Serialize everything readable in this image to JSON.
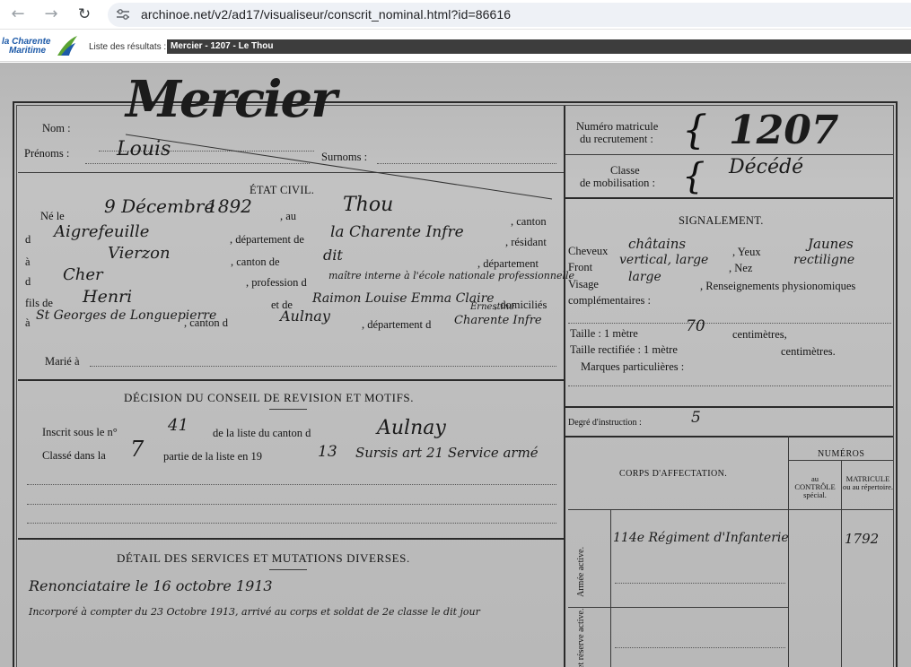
{
  "browser": {
    "url": "archinoe.net/v2/ad17/visualiseur/conscrit_nominal.html?id=86616",
    "icons": [
      "back-icon",
      "forward-icon",
      "reload-icon",
      "site-settings-icon"
    ]
  },
  "site": {
    "logo_line1": "la Charente",
    "logo_line2": "Maritime",
    "results_label": "Liste des résultats :",
    "document_title": "Mercier - 1207 - Le Thou",
    "colors": {
      "logo_blue": "#1d5aa8",
      "logo_green": "#5aa332",
      "title_bar": "#3d3d3d"
    }
  },
  "document": {
    "labels": {
      "nom": "Nom :",
      "prenoms": "Prénoms :",
      "surnoms": "Surnoms :",
      "etat_civil": "ÉTAT CIVIL.",
      "ne_le": "Né le",
      "au": ", au",
      "canton": ", canton",
      "d1": "d",
      "departement_de": ", département de",
      "resident": ", résidant",
      "a1": "à",
      "canton_de": ", canton de",
      "departement": ", département",
      "d2": "d",
      "profession": ", profession d",
      "fils_de": "fils de",
      "et_de": "et de",
      "domicilies": ", domiciliés",
      "a2": "à",
      "canton_d": ", canton d",
      "departement_d": ", département d",
      "marie_a": "Marié à",
      "decision": "DÉCISION DU CONSEIL DE REVISION ET MOTIFS.",
      "inscrit": "Inscrit sous le n°",
      "liste_canton": "de la liste du canton d",
      "classe_dans": "Classé dans la",
      "partie": "partie de la liste en 19",
      "detail": "DÉTAIL DES SERVICES ET MUTATIONS DIVERSES.",
      "numero_matricule_1": "Numéro matricule",
      "numero_matricule_2": "du recrutement :",
      "classe_1": "Classe",
      "classe_2": "de mobilisation :",
      "signalement": "SIGNALEMENT.",
      "cheveux": "Cheveux",
      "yeux": ", Yeux",
      "front": "Front",
      "nez": ", Nez",
      "visage": "Visage",
      "renseignements": ", Renseignements physionomiques",
      "complementaires": "complémentaires :",
      "taille": "Taille : 1 mètre",
      "centimetres": "centimètres,",
      "taille_rectifiee": "Taille rectifiée : 1 mètre",
      "centimetres2": "centimètres.",
      "marques": "Marques particulières :",
      "degre": "Degré d'instruction :",
      "numeros": "NUMÉROS",
      "corps": "CORPS D'AFFECTATION.",
      "au_controle": "au CONTRÔLE spécial.",
      "matricule_rep": "MATRICULE ou au répertoire.",
      "armee_active": "Armée active.",
      "reserve_active": "et réserve active."
    },
    "handwriting": {
      "nom": "Mercier",
      "prenoms": "Louis",
      "jour_mois": "9 Décembre",
      "annee": "1892",
      "lieu_naissance": "Thou",
      "canton_naissance": "Aigrefeuille",
      "departement_naissance": "la Charente Infre",
      "residence": "Vierzon",
      "canton_residence": "dit",
      "departement_residence": "Cher",
      "profession": "maître interne à l'école nationale professionnelle",
      "pere": "Henri",
      "mere": "Raimon Louise Emma Claire",
      "mere_extra": "Ernestine",
      "domicile": "St Georges de Longuepierre",
      "canton_domicile": "Aulnay",
      "departement_domicile": "Charente Infre",
      "numero_matricule": "1207",
      "classe": "Décédé",
      "cheveux": "châtains",
      "yeux": "Jaunes",
      "front": "vertical, large",
      "nez": "rectiligne",
      "visage": "large",
      "taille_cm": "70",
      "degre": "5",
      "numero_liste": "41",
      "canton_liste": "Aulnay",
      "partie": "7",
      "annee_liste": "13",
      "motif": "Sursis art 21 Service armé",
      "corps": "114e Régiment d'Infanterie",
      "matricule_corps": "1792",
      "service_1": "Renonciataire le 16 octobre 1913",
      "service_2": "Incorporé à compter du 23 Octobre 1913, arrivé au corps et soldat de 2e classe le dit jour"
    }
  }
}
